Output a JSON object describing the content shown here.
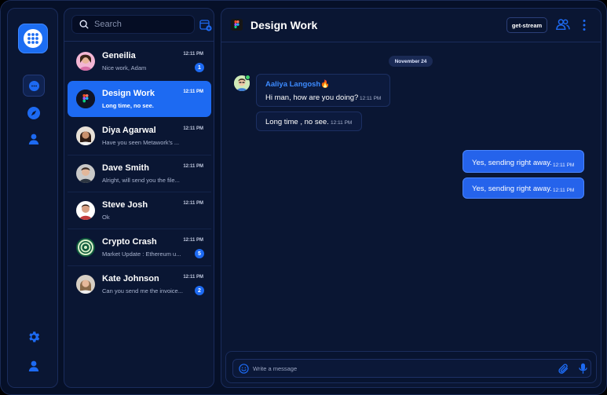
{
  "search": {
    "placeholder": "Search"
  },
  "conversations": [
    {
      "name": "Geneilia",
      "preview": "Nice work, Adam",
      "time": "12:11 PM",
      "badge": "1"
    },
    {
      "name": "Design Work",
      "preview": "Long time, no see.",
      "time": "12:11 PM",
      "badge": ""
    },
    {
      "name": "Diya Agarwal",
      "preview": "Have you seen Metawork's ...",
      "time": "12:11 PM",
      "badge": ""
    },
    {
      "name": "Dave Smith",
      "preview": "Alright, will send you the file...",
      "time": "12:11 PM",
      "badge": ""
    },
    {
      "name": "Steve Josh",
      "preview": "Ok",
      "time": "12:11 PM",
      "badge": ""
    },
    {
      "name": "Crypto Crash",
      "preview": "Market Update : Ethereum u...",
      "time": "12:11 PM",
      "badge": "5"
    },
    {
      "name": "Kate Johnson",
      "preview": "Can you send me the invoice...",
      "time": "12:11 PM",
      "badge": "2"
    }
  ],
  "chat": {
    "title": "Design Work",
    "stream_button": "get-stream",
    "date_divider": "November 24",
    "sender_name": "Aaliya Langosh🔥",
    "messages": [
      {
        "text": "Hi man, how are you doing?",
        "time": "12:11 PM"
      },
      {
        "text": "Long time , no see.",
        "time": "12:11 PM"
      },
      {
        "text": "Yes, sending right away.",
        "time": "12:11 PM"
      },
      {
        "text": "Yes, sending right away.",
        "time": "12:11 PM"
      }
    ],
    "composer_placeholder": "Write a message"
  },
  "icons": {
    "rail": [
      "apps-grid-icon",
      "chat-bubble-icon",
      "compass-icon",
      "user-icon",
      "gear-icon",
      "user-icon"
    ],
    "header": [
      "users-icon",
      "more-vertical-icon"
    ],
    "composer": [
      "emoji-icon",
      "paperclip-icon",
      "microphone-icon"
    ]
  },
  "colors": {
    "accent": "#1d6af2",
    "background": "#061028",
    "panel": "#0a1633",
    "outgoing_bubble": "#2563eb",
    "sender_name": "#3d8bff"
  }
}
